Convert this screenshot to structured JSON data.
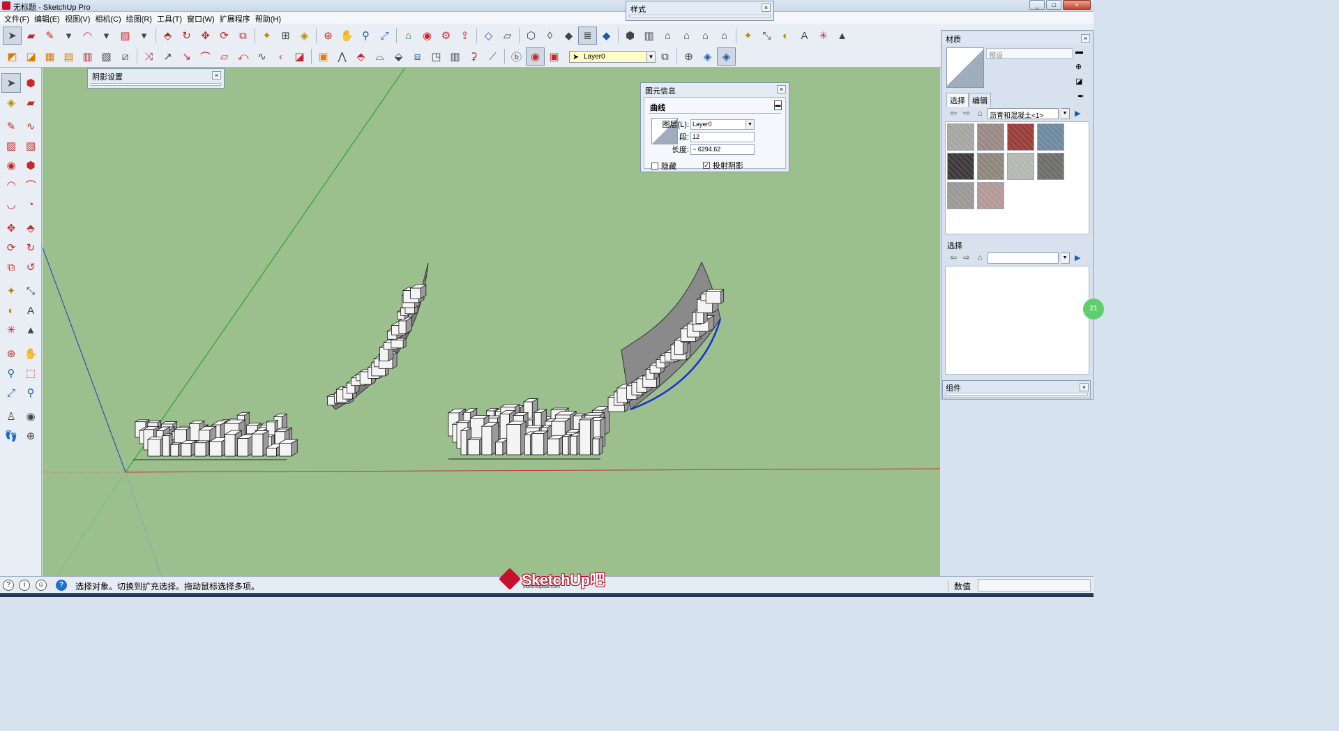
{
  "window": {
    "title": "无标题 - SketchUp Pro",
    "minimize": "_",
    "maximize": "□",
    "close": "×"
  },
  "menu": [
    "文件(F)",
    "编辑(E)",
    "视图(V)",
    "相机(C)",
    "绘图(R)",
    "工具(T)",
    "窗口(W)",
    "扩展程序",
    "帮助(H)"
  ],
  "panels": {
    "styles": {
      "title": "样式",
      "close": "×"
    },
    "shadow": {
      "title": "阴影设置",
      "close": "×"
    }
  },
  "layer_toolbar": {
    "current_layer": "Layer0"
  },
  "entity_info": {
    "title": "图元信息",
    "close": "×",
    "type": "曲线",
    "layer_label": "图层(L):",
    "layer_value": "Layer0",
    "segments_label": "段:",
    "segments_value": "12",
    "length_label": "长度:",
    "length_value": "~ 6294.62",
    "hidden_label": "隐藏",
    "hidden_checked": false,
    "cast_shadow_label": "投射阴影",
    "cast_shadow_checked": true
  },
  "materials": {
    "title": "材质",
    "close": "×",
    "name_placeholder": "预设",
    "tabs": [
      "选择",
      "编辑"
    ],
    "library": "沥青和混凝土<1>",
    "swatch_colors": [
      "#a6a6a2",
      "#9a8a86",
      "#9a3e3a",
      "#6f8aa0",
      "#3e3a3c",
      "#8f877c",
      "#b5b8b2",
      "#6e6e6c",
      "#9b9a97",
      "#b39a98"
    ],
    "secondary_label": "选择",
    "secondary_library": ""
  },
  "components": {
    "title": "组件",
    "close": "×"
  },
  "status": {
    "message": "选择对象。切换到扩充选择。拖动鼠标选择多项。",
    "measurements_label": "数值",
    "measurements_value": ""
  },
  "watermark": {
    "brand": "SketchUp吧",
    "url": "sketchupbar.com"
  },
  "badge": "21"
}
